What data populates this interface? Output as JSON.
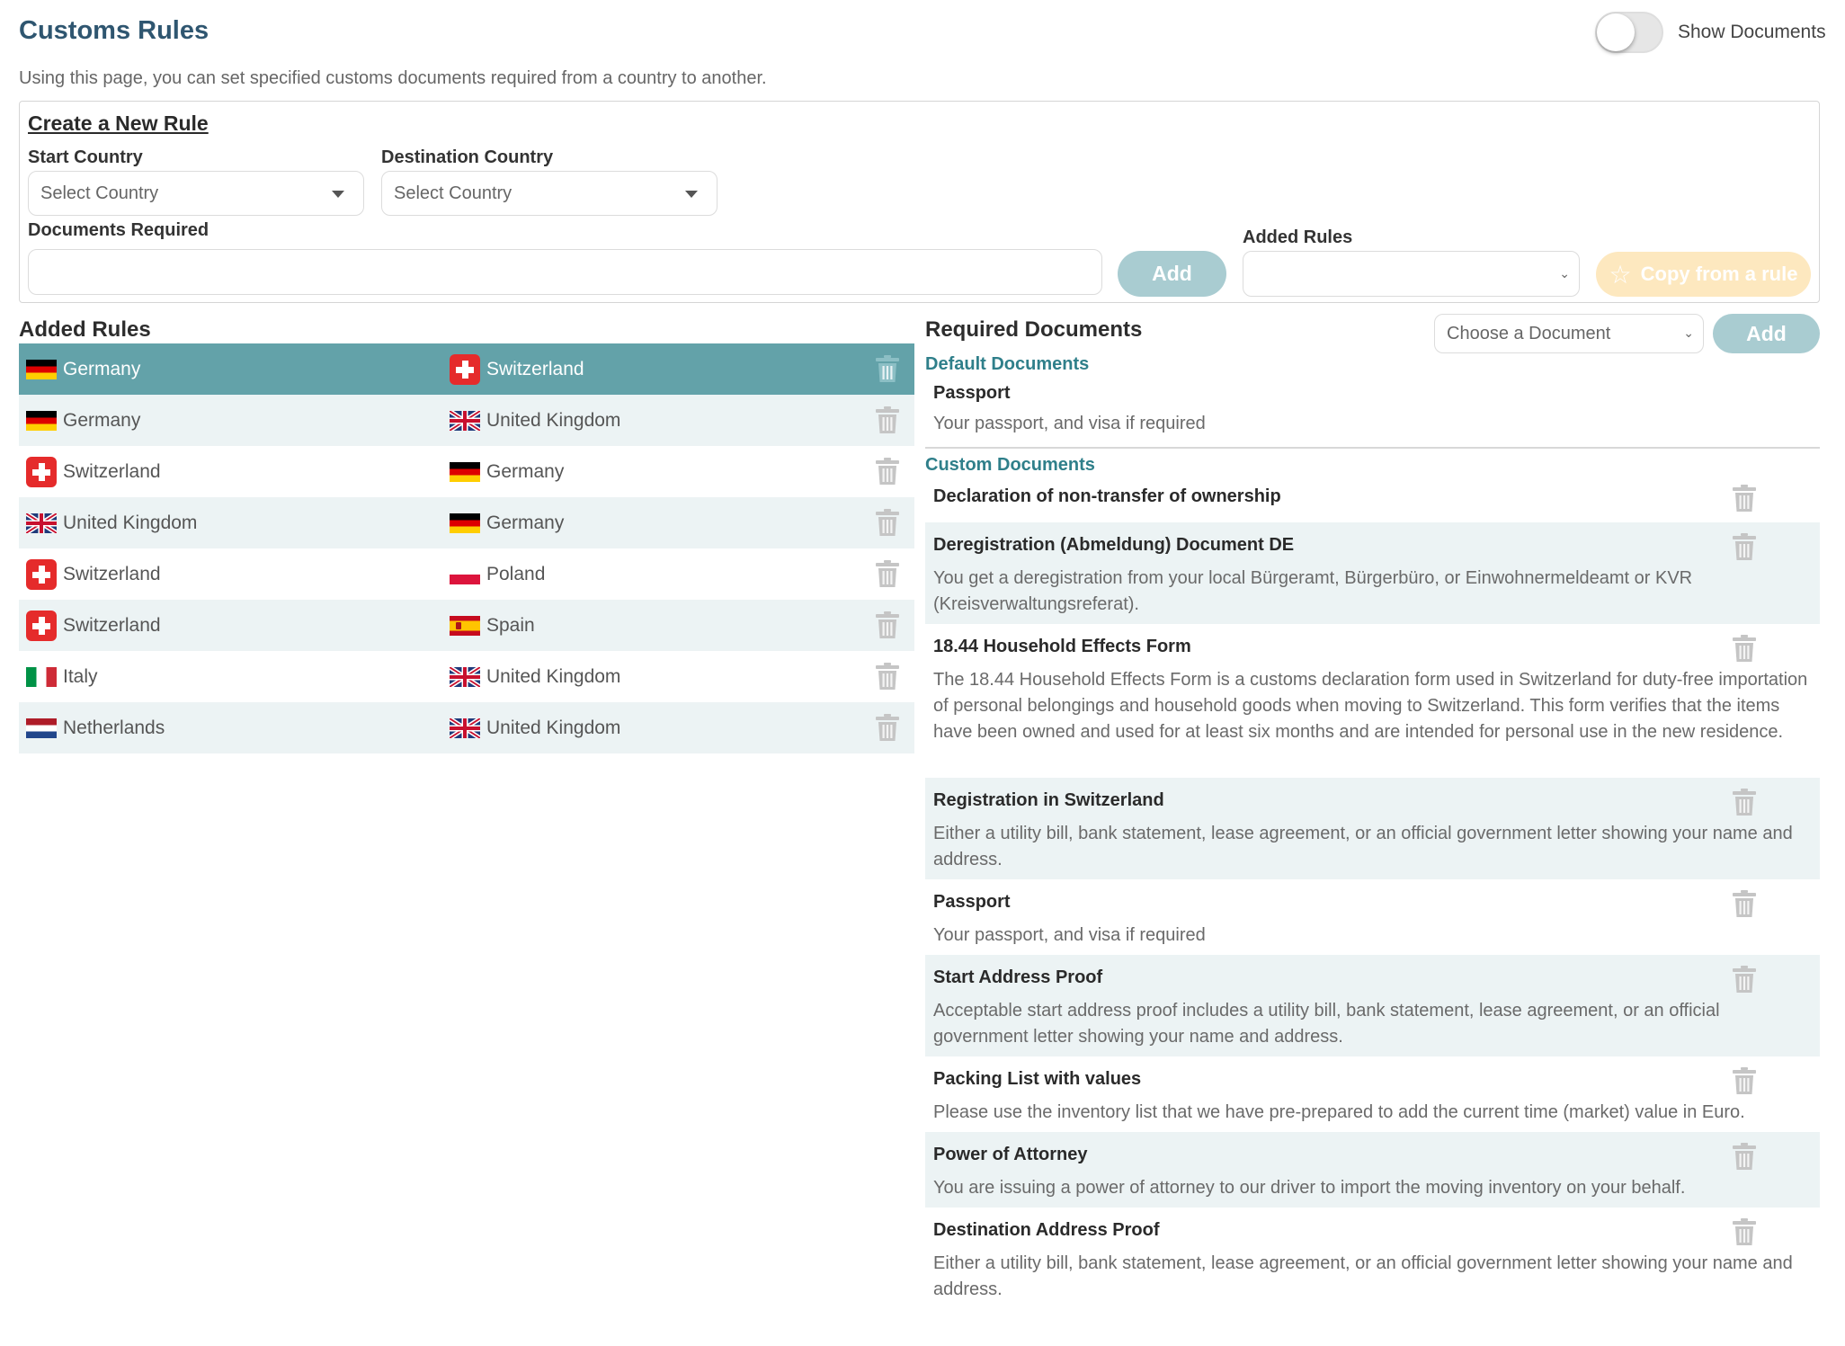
{
  "header": {
    "title": "Customs Rules",
    "toggle_label": "Show Documents",
    "intro": "Using this page, you can set specified customs documents required from a country to another."
  },
  "create_rule": {
    "title": "Create a New Rule",
    "start_country_label": "Start Country",
    "start_country_value": "Select Country",
    "destination_country_label": "Destination Country",
    "destination_country_value": "Select Country",
    "documents_required_label": "Documents Required",
    "documents_required_value": "",
    "add_label": "Add",
    "added_rules_label": "Added Rules",
    "added_rules_value": "",
    "copy_label": "Copy from a rule"
  },
  "added_rules": {
    "title": "Added Rules",
    "rows": [
      {
        "from": "Germany",
        "from_flag": "de",
        "to": "Switzerland",
        "to_flag": "ch",
        "selected": true
      },
      {
        "from": "Germany",
        "from_flag": "de",
        "to": "United Kingdom",
        "to_flag": "uk",
        "selected": false
      },
      {
        "from": "Switzerland",
        "from_flag": "ch",
        "to": "Germany",
        "to_flag": "de",
        "selected": false
      },
      {
        "from": "United Kingdom",
        "from_flag": "uk",
        "to": "Germany",
        "to_flag": "de",
        "selected": false
      },
      {
        "from": "Switzerland",
        "from_flag": "ch",
        "to": "Poland",
        "to_flag": "pl",
        "selected": false
      },
      {
        "from": "Switzerland",
        "from_flag": "ch",
        "to": "Spain",
        "to_flag": "es",
        "selected": false
      },
      {
        "from": "Italy",
        "from_flag": "it",
        "to": "United Kingdom",
        "to_flag": "uk",
        "selected": false
      },
      {
        "from": "Netherlands",
        "from_flag": "nl",
        "to": "United Kingdom",
        "to_flag": "uk",
        "selected": false
      }
    ]
  },
  "required_documents": {
    "title": "Required Documents",
    "choose_placeholder": "Choose a Document",
    "add_label": "Add",
    "default_title": "Default Documents",
    "default_docs": [
      {
        "name": "Passport",
        "desc": "Your passport, and visa if required"
      }
    ],
    "custom_title": "Custom Documents",
    "custom_docs": [
      {
        "name": "Declaration of non-transfer of ownership",
        "desc": ""
      },
      {
        "name": "Deregistration (Abmeldung) Document DE",
        "desc": "You get a deregistration from your local Bürgeramt, Bürgerbüro, or Einwohnermeldeamt or KVR (Kreisverwaltungsreferat)."
      },
      {
        "name": "18.44 Household Effects Form",
        "desc": "The 18.44 Household Effects Form is a customs declaration form used in Switzerland for duty-free importation of personal belongings and household goods when moving to Switzerland. This form verifies that the items have been owned and used for at least six months and are intended for personal use in the new residence."
      },
      {
        "name": "Registration in Switzerland",
        "desc": "Either a utility bill, bank statement, lease agreement, or an official government letter showing your name and address."
      },
      {
        "name": "Passport",
        "desc": "Your passport, and visa if required"
      },
      {
        "name": "Start Address Proof",
        "desc": "Acceptable start address proof includes a utility bill, bank statement, lease agreement, or an official government letter showing your name and address."
      },
      {
        "name": "Packing List with values",
        "desc": "Please use the inventory list that we have pre-prepared to add the current time (market) value in Euro."
      },
      {
        "name": "Power of Attorney",
        "desc": "You are issuing a power of attorney to our driver to import the moving inventory on your behalf."
      },
      {
        "name": "Destination Address Proof",
        "desc": "Either a utility bill, bank statement, lease agreement, or an official government letter showing your name and address."
      }
    ]
  },
  "colors": {
    "title": "#2f5670",
    "selected_row": "#63a2a9",
    "alt_row": "#ecf3f4",
    "add_button": "#a9ccd1",
    "copy_button": "#fde8bf",
    "section_accent": "#2f7f8a"
  },
  "icons": {
    "trash": "trash-icon",
    "dropdown": "caret-down-icon",
    "star": "star-icon"
  }
}
